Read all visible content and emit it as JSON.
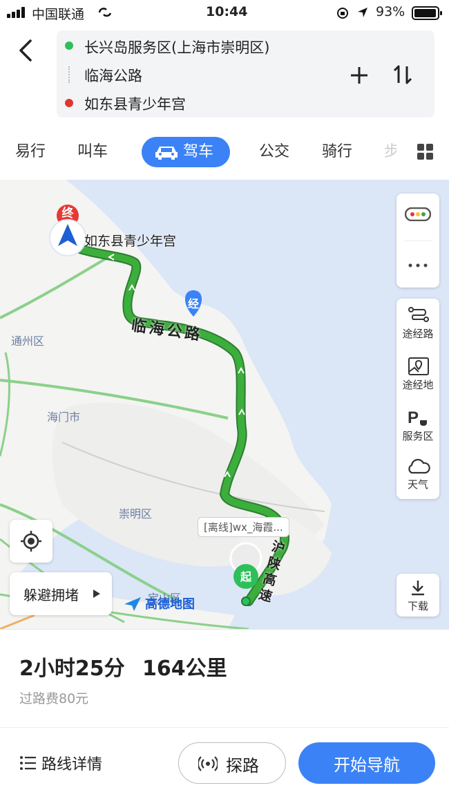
{
  "status_bar": {
    "carrier": "中国联通",
    "time": "10:44",
    "battery": "93%"
  },
  "route": {
    "start": "长兴岛服务区(上海市崇明区)",
    "via": "临海公路",
    "end": "如东县青少年宫",
    "colors": {
      "start": "#2fbf5a",
      "end": "#e0362f"
    }
  },
  "tabs": [
    {
      "label": "易行"
    },
    {
      "label": "叫车"
    },
    {
      "label": "驾车",
      "active": true
    },
    {
      "label": "公交"
    },
    {
      "label": "骑行"
    },
    {
      "label": "步"
    }
  ],
  "map": {
    "labels": {
      "end_marker": "终",
      "end_name": "如东县青少年宫",
      "via_marker": "经",
      "road": "临海公路",
      "tongzhou": "通州区",
      "haimen": "海门市",
      "chongming": "崇明区",
      "baoshan": "宝山区",
      "offline_bubble": "[离线]wx_海霞...",
      "start_marker": "起",
      "hu_shan": "沪陕高速",
      "logo": "高德地图"
    },
    "tools": {
      "waypoint_road": "途经路",
      "waypoint_place": "途经地",
      "service_area": "服务区",
      "weather": "天气",
      "download": "下载"
    },
    "avoid_jam": "躲避拥堵",
    "route_color": "#3cae3c"
  },
  "summary": {
    "duration": "2小时25分",
    "distance": "164公里",
    "toll": "过路费80元"
  },
  "actions": {
    "details": "路线详情",
    "explore": "探路",
    "start_nav": "开始导航"
  }
}
